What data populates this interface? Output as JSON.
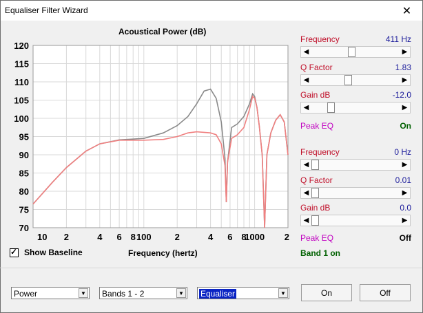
{
  "window": {
    "title": "Equaliser Filter Wizard",
    "close_glyph": "✕"
  },
  "chart_data": {
    "type": "line",
    "title": "Acoustical Power (dB)",
    "xlabel": "Frequency (hertz)",
    "x_scale": "log",
    "xlim": [
      10,
      2000
    ],
    "ylim": [
      70,
      120
    ],
    "x_tick_labels": [
      "10",
      "2",
      "4",
      "6",
      "8",
      "100",
      "2",
      "4",
      "6",
      "8",
      "1000",
      "2"
    ],
    "y_ticks": [
      70,
      75,
      80,
      85,
      90,
      95,
      100,
      105,
      110,
      115,
      120
    ],
    "grid": true,
    "series": [
      {
        "color": "#8a8a8a",
        "points": [
          [
            10,
            76.5
          ],
          [
            15,
            82.5
          ],
          [
            20,
            86.5
          ],
          [
            30,
            91
          ],
          [
            40,
            93
          ],
          [
            60,
            94.1
          ],
          [
            80,
            94.3
          ],
          [
            100,
            94.5
          ],
          [
            150,
            96
          ],
          [
            200,
            98
          ],
          [
            250,
            100.5
          ],
          [
            300,
            104
          ],
          [
            350,
            107.5
          ],
          [
            400,
            108
          ],
          [
            450,
            105.5
          ],
          [
            500,
            99
          ],
          [
            540,
            89
          ],
          [
            555,
            77
          ],
          [
            570,
            88
          ],
          [
            620,
            97.5
          ],
          [
            700,
            98.5
          ],
          [
            800,
            100.5
          ],
          [
            900,
            104
          ],
          [
            960,
            106.7
          ],
          [
            1000,
            106
          ],
          [
            1050,
            103
          ],
          [
            1100,
            98
          ],
          [
            1170,
            90
          ],
          [
            1230,
            70
          ],
          [
            1290,
            90
          ],
          [
            1400,
            96
          ],
          [
            1550,
            99.5
          ],
          [
            1700,
            101
          ],
          [
            1850,
            99
          ],
          [
            2000,
            90
          ]
        ]
      },
      {
        "color": "#f08080",
        "points": [
          [
            10,
            76.5
          ],
          [
            15,
            82.5
          ],
          [
            20,
            86.5
          ],
          [
            30,
            91
          ],
          [
            40,
            93
          ],
          [
            60,
            94
          ],
          [
            80,
            94
          ],
          [
            100,
            94
          ],
          [
            150,
            94.2
          ],
          [
            200,
            95
          ],
          [
            250,
            96
          ],
          [
            300,
            96.3
          ],
          [
            400,
            96
          ],
          [
            450,
            95.5
          ],
          [
            500,
            93
          ],
          [
            540,
            87
          ],
          [
            555,
            77
          ],
          [
            570,
            88
          ],
          [
            620,
            94.5
          ],
          [
            700,
            95.5
          ],
          [
            800,
            97.5
          ],
          [
            900,
            102.5
          ],
          [
            960,
            106
          ],
          [
            1000,
            105.5
          ],
          [
            1050,
            103
          ],
          [
            1100,
            98
          ],
          [
            1170,
            90
          ],
          [
            1230,
            70
          ],
          [
            1290,
            90
          ],
          [
            1400,
            96
          ],
          [
            1550,
            99.5
          ],
          [
            1700,
            101
          ],
          [
            1850,
            99
          ],
          [
            2000,
            90
          ]
        ]
      }
    ]
  },
  "baseline": {
    "label": "Show Baseline",
    "checked": true
  },
  "band1": {
    "frequency": {
      "label": "Frequency",
      "value": "411 Hz",
      "level": 0.45
    },
    "q_factor": {
      "label": "Q Factor",
      "value": "1.83",
      "level": 0.41
    },
    "gain": {
      "label": "Gain  dB",
      "value": "-12.0",
      "level": 0.2
    },
    "mode": {
      "label": "Peak EQ",
      "state": "On"
    }
  },
  "band2": {
    "frequency": {
      "label": "Frequency",
      "value": "0 Hz",
      "level": 0.0
    },
    "q_factor": {
      "label": "Q Factor",
      "value": "0.01",
      "level": 0.0
    },
    "gain": {
      "label": "Gain  dB",
      "value": "0.0",
      "level": 0.0
    },
    "mode": {
      "label": "Peak EQ",
      "state": "Off"
    }
  },
  "status": "Band 1 on",
  "controls": {
    "view_select": "Power",
    "bands_select": "Bands 1 - 2",
    "mode_select": "Equaliser",
    "on_button": "On",
    "off_button": "Off"
  },
  "icons": {
    "scroll_left": "◀",
    "scroll_right": "▶",
    "dropdown": "▼",
    "check": "✓"
  }
}
